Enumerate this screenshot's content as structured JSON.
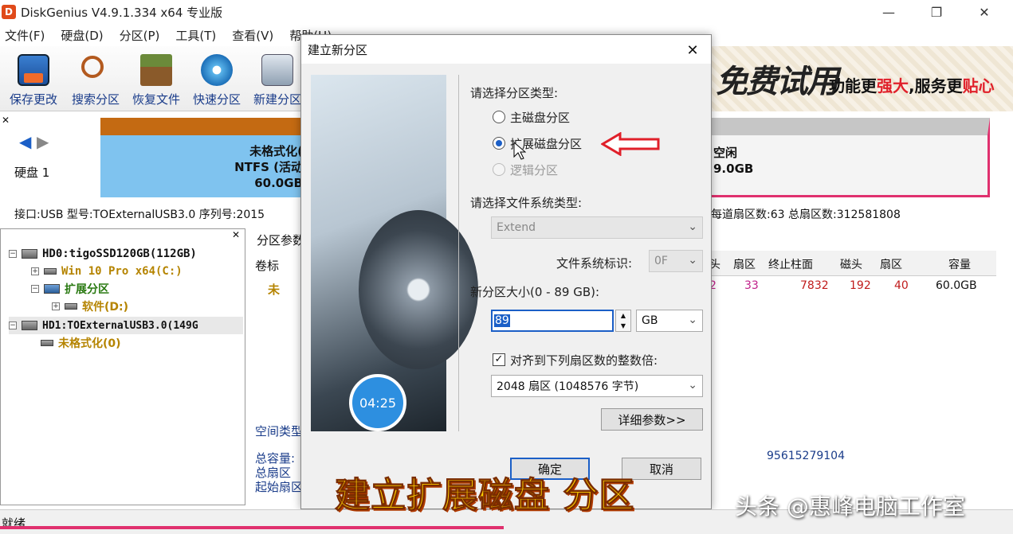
{
  "window": {
    "title": "DiskGenius V4.9.1.334 x64 专业版",
    "logo": "D"
  },
  "menu": [
    "文件(F)",
    "硬盘(D)",
    "分区(P)",
    "工具(T)",
    "查看(V)",
    "帮助(H)"
  ],
  "toolbar": [
    "保存更改",
    "搜索分区",
    "恢复文件",
    "快速分区",
    "新建分区"
  ],
  "banner": {
    "big": "免费试用",
    "pre": "功能更",
    "strong": "强大",
    "mid": ",服务更",
    "end": "贴心"
  },
  "diskmap": {
    "disk_label": "硬盘 1",
    "part1": {
      "line1": "未格式化(",
      "line2": "NTFS (活动",
      "line3": "60.0GB"
    },
    "part2": {
      "line1": "空闲",
      "line2": "9.0GB"
    }
  },
  "info_line": {
    "left": "接口:USB  型号:TOExternalUSB3.0  序列号:2015",
    "right": "每道扇区数:63  总扇区数:312581808"
  },
  "tree": {
    "hd0": "HD0:tigoSSD120GB(112GB)",
    "win": "Win 10 Pro x64(C:)",
    "ext": "扩展分区",
    "soft": "软件(D:)",
    "hd1": "HD1:TOExternalUSB3.0(149G",
    "unformatted": "未格式化(0)"
  },
  "right": {
    "tab": "分区参数",
    "col_label": "卷标",
    "row_label": "未",
    "headers": [
      "头",
      "扇区",
      "终止柱面",
      "磁头",
      "扇区",
      "容量"
    ],
    "row": [
      "2",
      "33",
      "7832",
      "192",
      "40",
      "60.0GB"
    ],
    "space_type": "空间类型",
    "total_cap": "总容量:",
    "total_sec": "总扇区",
    "start_sec": "起始扇区",
    "sector_num": "95615279104"
  },
  "dialog": {
    "title": "建立新分区",
    "time": "04:25",
    "part_type_label": "请选择分区类型:",
    "opt_primary": "主磁盘分区",
    "opt_extended": "扩展磁盘分区",
    "opt_logical": "逻辑分区",
    "fs_label": "请选择文件系统类型:",
    "fs_value": "Extend",
    "fs_id_label": "文件系统标识:",
    "fs_id_value": "0F",
    "size_label": "新分区大小(0 - 89 GB):",
    "size_value": "89",
    "unit": "GB",
    "align_label": "对齐到下列扇区数的整数倍:",
    "align_value": "2048 扇区 (1048576 字节)",
    "advanced": "详细参数>>",
    "ok": "确定",
    "cancel": "取消"
  },
  "status": "就绪",
  "caption": "建立扩展磁盘 分区",
  "watermark": "头条 @惠峰电脑工作室"
}
